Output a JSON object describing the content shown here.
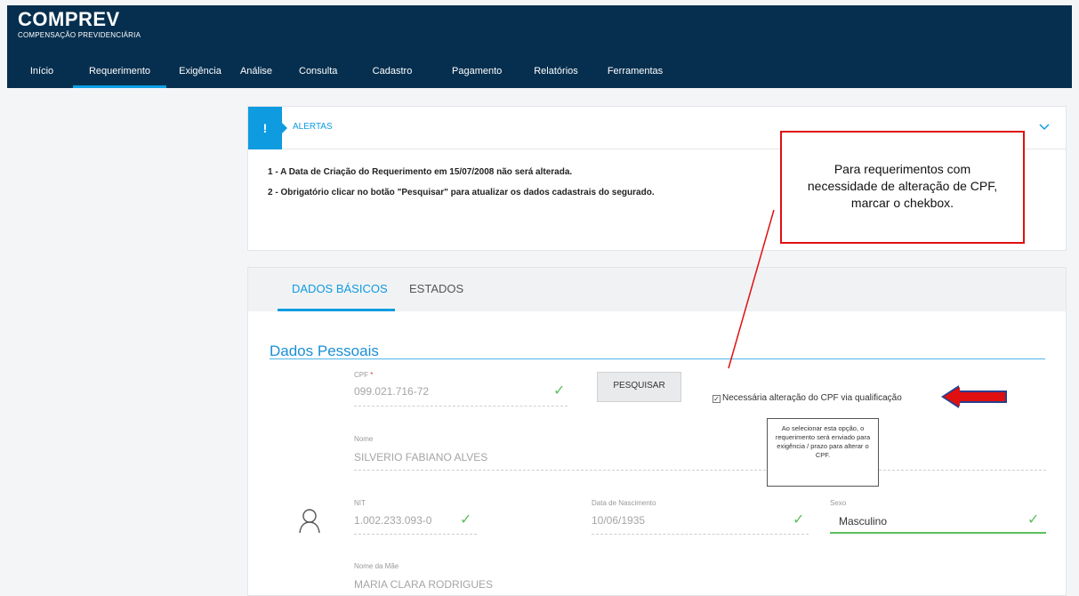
{
  "app": {
    "title": "COMPREV",
    "subtitle": "COMPENSAÇÃO PREVIDENCIÁRIA"
  },
  "nav": {
    "items": [
      "Início",
      "Requerimento",
      "Exigência",
      "Análise",
      "Consulta",
      "Cadastro",
      "Pagamento",
      "Relatórios",
      "Ferramentas"
    ],
    "active": "Requerimento"
  },
  "alerts": {
    "icon": "exclamation-icon",
    "title": "ALERTAS",
    "line1": "1 - A Data de Criação do Requerimento em 15/07/2008 não será alterada.",
    "line2": "2 - Obrigatório clicar no botão \"Pesquisar\" para atualizar os dados cadastrais do segurado."
  },
  "tabs": {
    "basic": "DADOS BÁSICOS",
    "states": "ESTADOS"
  },
  "section": {
    "title": "Dados Pessoais"
  },
  "form": {
    "cpf_label": "CPF",
    "cpf_required": "*",
    "cpf_value": "099.021.716-72",
    "search_button": "PESQUISAR",
    "checkbox_label": "Necessária alteração do CPF via qualificação",
    "checkbox_checked": true,
    "name_label": "Nome",
    "name_value": "SILVERIO FABIANO ALVES",
    "nit_label": "NIT",
    "nit_value": "1.002.233.093-0",
    "birth_label": "Data de Nascimento",
    "birth_value": "10/06/1935",
    "sex_label": "Sexo",
    "sex_value": "Masculino",
    "mother_label": "Nome da Mãe",
    "mother_value": "MARIA CLARA RODRIGUES"
  },
  "tooltip": {
    "text": "Ao selecionar esta opção, o requerimento será enviado para exigência / prazo para alterar o CPF."
  },
  "annotation": {
    "text": "Para requerimentos com necessidade de alteração de CPF, marcar o chekbox."
  },
  "colors": {
    "header_bg": "#062f4f",
    "accent": "#0e9be0",
    "ok_green": "#5cbf5c",
    "annotation_red": "#e01010"
  }
}
